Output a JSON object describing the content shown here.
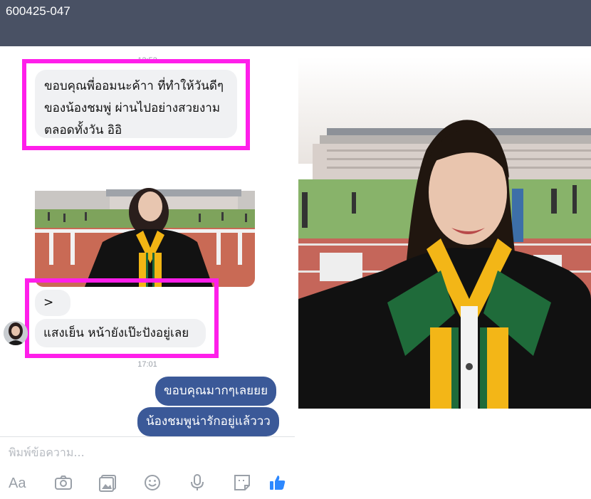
{
  "header": {
    "title": "600425-047"
  },
  "chat": {
    "timestamps": [
      "12:52",
      "17:01"
    ],
    "incoming_1_lines": [
      "ขอบคุณพี่ออมนะค้าา ที่ทำให้วันดีๆ",
      "ของน้องชมพู่ ผ่านไปอย่างสวยงาม",
      "ตลอดทั้งวัน อิอิ"
    ],
    "incoming_2": "><",
    "incoming_3": "แสงเย็น หน้ายังเป๊ะปังอยู่เลย",
    "outgoing_1": "ขอบคุณมากๆเลยยย",
    "outgoing_2": "น้องชมพูน่ารักอยู่แล้ววว"
  },
  "compose": {
    "placeholder": "พิมพ์ข้อความ...",
    "aa_label": "Aa",
    "icons": [
      "camera-icon",
      "gallery-icon",
      "emoji-icon",
      "microphone-icon",
      "sticker-icon",
      "thumbs-up-icon"
    ]
  },
  "colors": {
    "header": "#495164",
    "outgoing_bubble": "#3b5998",
    "incoming_bubble": "#f0f1f3",
    "highlight": "#ff1eea",
    "like": "#2d88ff"
  }
}
